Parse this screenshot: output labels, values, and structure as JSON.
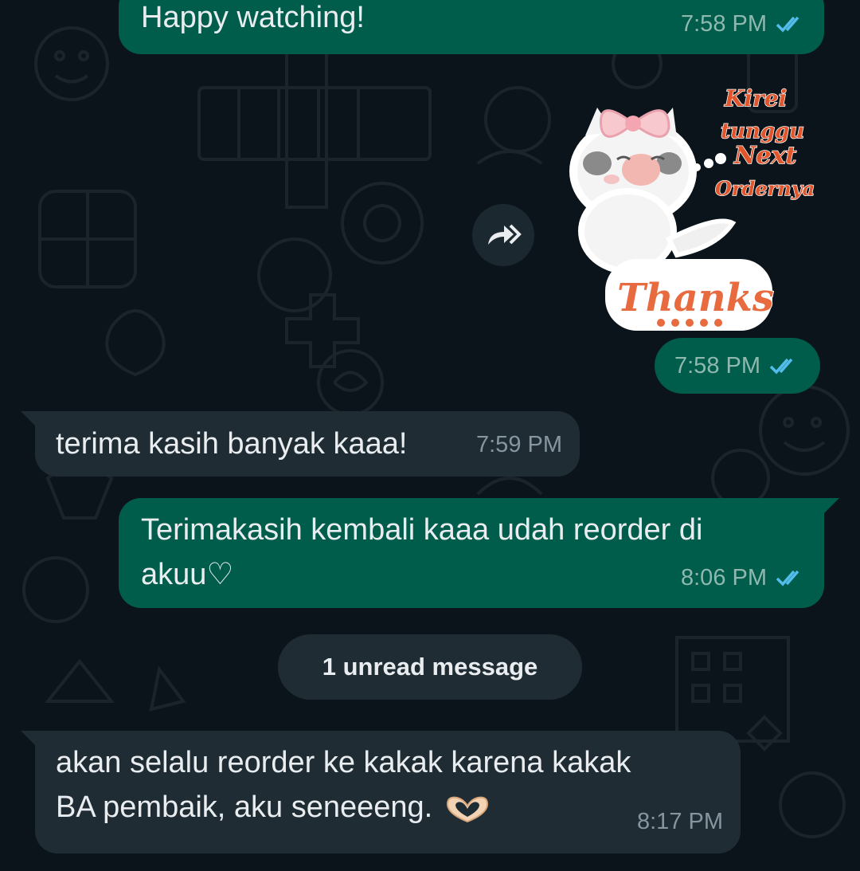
{
  "messages": [
    {
      "direction": "out",
      "text": "Happy watching!",
      "time": "7:58 PM",
      "status": "read"
    },
    {
      "direction": "out",
      "type": "sticker",
      "sticker_text": [
        "Kirei",
        "tunggu",
        "Next",
        "Ordernya"
      ],
      "sticker_caption": "Thanks",
      "time": "7:58 PM",
      "status": "read"
    },
    {
      "direction": "in",
      "text": "terima kasih banyak kaaa!",
      "time": "7:59 PM"
    },
    {
      "direction": "out",
      "text": "Terimakasih kembali kaaa udah reorder di akuu♡",
      "text_line1": "Terimakasih kembali kaaa udah reorder di",
      "text_line2": "akuu♡",
      "time": "8:06 PM",
      "status": "read"
    },
    {
      "direction": "in",
      "text_line1": "akan selalu reorder ke kakak karena kakak",
      "text_line2": "BA pembaik, aku seneeeng.",
      "emoji": "heart-hands-emoji",
      "time": "8:17 PM"
    }
  ],
  "unread_divider": "1 unread message",
  "icons": {
    "forward": "forward-icon",
    "read_receipt": "double-check-icon"
  },
  "colors": {
    "background": "#0b141a",
    "outgoing_bubble": "#005c4b",
    "incoming_bubble": "#1f2c34",
    "read_tick": "#53bdeb",
    "text": "#e9edef"
  }
}
